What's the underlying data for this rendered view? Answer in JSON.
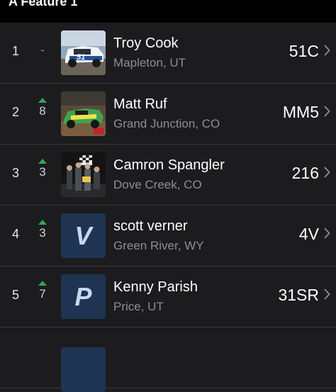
{
  "header": {
    "title": "A Feature 1"
  },
  "rows": [
    {
      "pos": "1",
      "change": "-",
      "change_dir": "none",
      "name": "Troy Cook",
      "location": "Mapleton, UT",
      "car": "51C",
      "thumb": "photo-car-blue"
    },
    {
      "pos": "2",
      "change": "8",
      "change_dir": "up",
      "name": "Matt Ruf",
      "location": "Grand Junction, CO",
      "car": "MM5",
      "thumb": "photo-car-green"
    },
    {
      "pos": "3",
      "change": "3",
      "change_dir": "up",
      "name": "Camron Spangler",
      "location": "Dove Creek, CO",
      "car": "216",
      "thumb": "photo-victory-lane"
    },
    {
      "pos": "4",
      "change": "3",
      "change_dir": "up",
      "name": "scott verner",
      "location": "Green River, WY",
      "car": "4V",
      "thumb": "letter",
      "letter": "V"
    },
    {
      "pos": "5",
      "change": "7",
      "change_dir": "up",
      "name": "Kenny Parish",
      "location": "Price, UT",
      "car": "31SR",
      "thumb": "letter",
      "letter": "P"
    }
  ],
  "colors": {
    "background": "#1c1c1e",
    "up_arrow": "#34a853",
    "avatar_bg": "#1e3452",
    "secondary_text": "#8e8e93"
  }
}
